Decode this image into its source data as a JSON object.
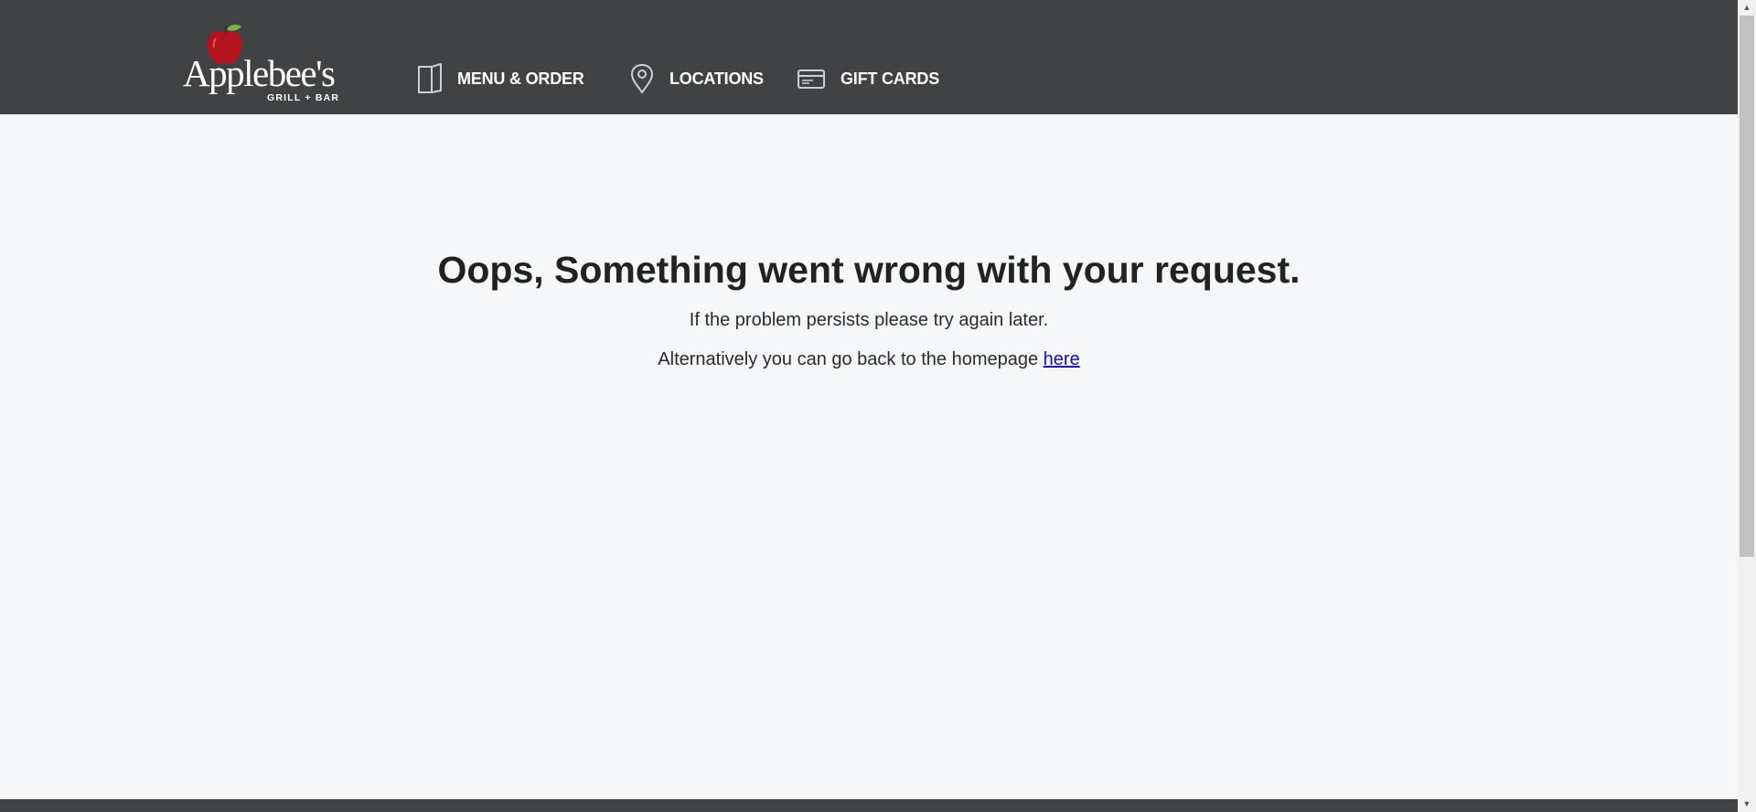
{
  "header": {
    "logo": {
      "wordmark": "Applebee's",
      "tagline": "GRILL + BAR"
    },
    "nav": [
      {
        "label": "MENU & ORDER",
        "icon": "menu-book-icon"
      },
      {
        "label": "LOCATIONS",
        "icon": "location-pin-icon"
      },
      {
        "label": "GIFT CARDS",
        "icon": "gift-card-icon"
      }
    ]
  },
  "error": {
    "title": "Oops, Something went wrong with your request.",
    "line1": "If the problem persists please try again later.",
    "line2_prefix": "Alternatively you can go back to the homepage ",
    "link_text": "here"
  },
  "colors": {
    "header_bg": "#414244",
    "page_bg": "#f6f7f9",
    "link": "#1a0dab",
    "apple_red": "#b3121f",
    "leaf_green": "#7cb342"
  }
}
